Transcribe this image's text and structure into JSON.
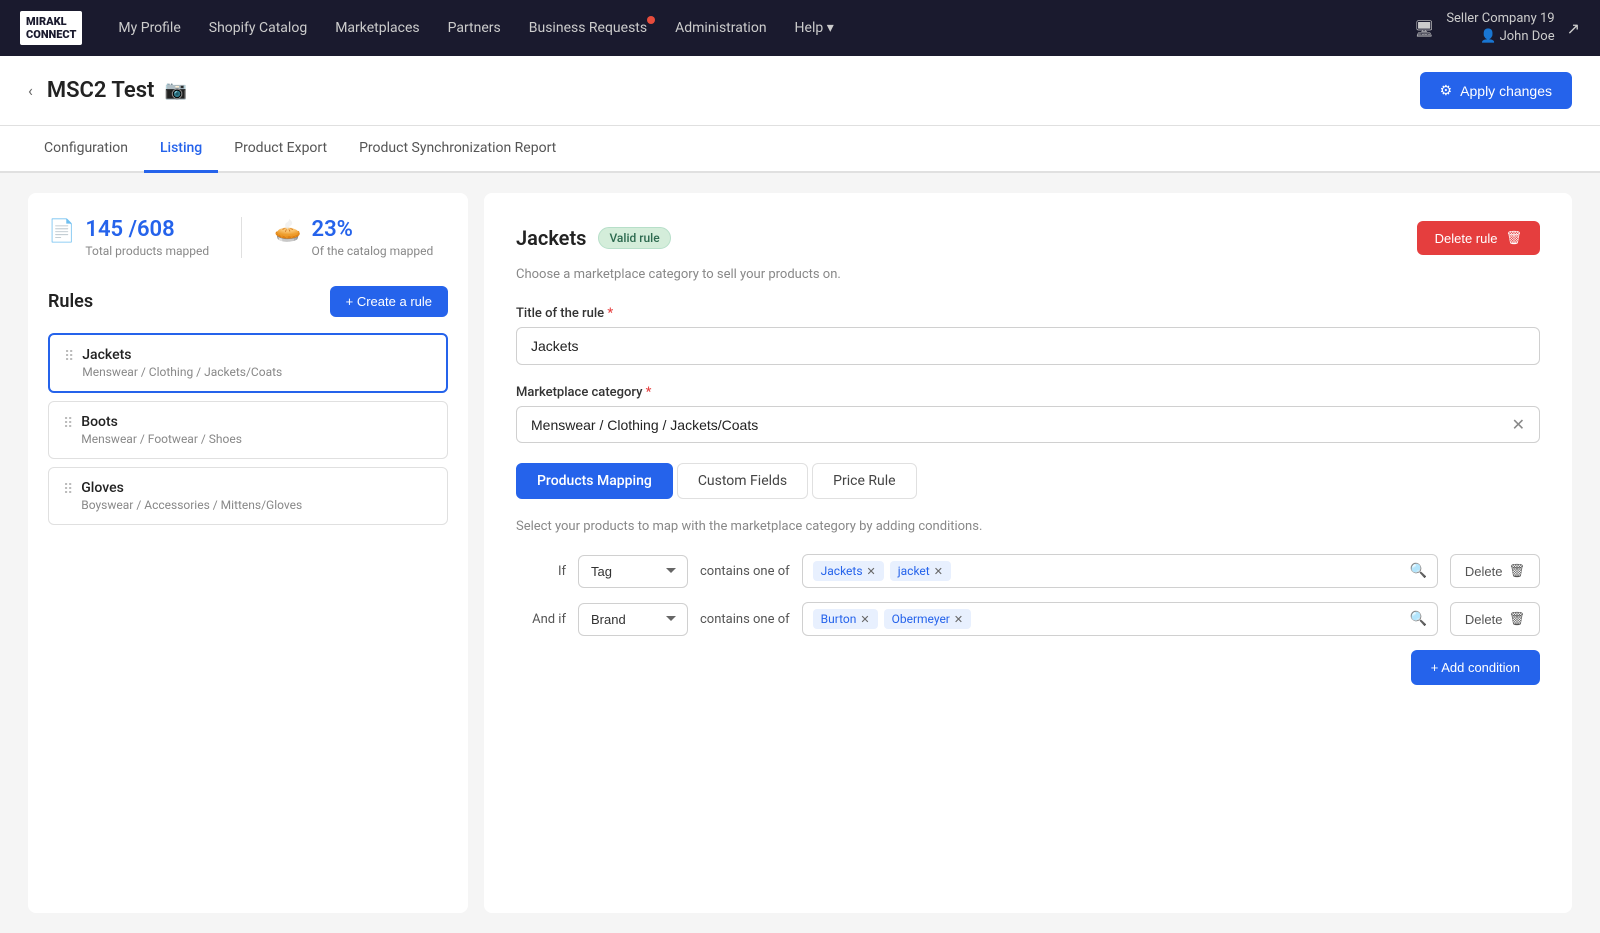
{
  "topnav": {
    "logo_line1": "MIRAKL",
    "logo_line2": "CONNECT",
    "links": [
      {
        "label": "My Profile",
        "badge": false
      },
      {
        "label": "Shopify Catalog",
        "badge": false
      },
      {
        "label": "Marketplaces",
        "badge": false
      },
      {
        "label": "Partners",
        "badge": false
      },
      {
        "label": "Business Requests",
        "badge": true
      },
      {
        "label": "Administration",
        "badge": false
      },
      {
        "label": "Help ▾",
        "badge": false
      }
    ],
    "company": "Seller Company 19",
    "user": "John Doe"
  },
  "page": {
    "back_label": "‹",
    "title": "MSC2 Test",
    "apply_btn": "Apply changes",
    "gear_icon": "⚙"
  },
  "tabs": [
    {
      "label": "Configuration",
      "active": false
    },
    {
      "label": "Listing",
      "active": true
    },
    {
      "label": "Product Export",
      "active": false
    },
    {
      "label": "Product Synchronization Report",
      "active": false
    }
  ],
  "left_panel": {
    "stat1": {
      "number": "145 /608",
      "label": "Total products mapped"
    },
    "stat2": {
      "number": "23%",
      "label": "Of the catalog mapped"
    },
    "rules_title": "Rules",
    "create_rule_btn": "+ Create a rule",
    "rules": [
      {
        "name": "Jackets",
        "path": "Menswear / Clothing / Jackets/Coats",
        "active": true
      },
      {
        "name": "Boots",
        "path": "Menswear / Footwear / Shoes",
        "active": false
      },
      {
        "name": "Gloves",
        "path": "Boyswear / Accessories / Mittens/Gloves",
        "active": false
      }
    ]
  },
  "right_panel": {
    "rule_title": "Jackets",
    "valid_badge": "Valid rule",
    "delete_btn": "Delete rule",
    "subtitle": "Choose a marketplace category to sell your products on.",
    "title_label": "Title of the rule",
    "required_marker": "*",
    "title_value": "Jackets",
    "category_label": "Marketplace category",
    "category_value": "Menswear / Clothing / Jackets/Coats",
    "sub_tabs": [
      {
        "label": "Products Mapping",
        "active": true
      },
      {
        "label": "Custom Fields",
        "active": false
      },
      {
        "label": "Price Rule",
        "active": false
      }
    ],
    "mapping_desc": "Select your products to map with the marketplace category by adding conditions.",
    "conditions": [
      {
        "prefix": "If",
        "field": "Tag",
        "operator": "contains one of",
        "tags": [
          "Jackets",
          "jacket"
        ],
        "delete_label": "Delete"
      },
      {
        "prefix": "And if",
        "field": "Brand",
        "operator": "contains one of",
        "tags": [
          "Burton",
          "Obermeyer"
        ],
        "delete_label": "Delete"
      }
    ],
    "add_condition_btn": "+ Add condition"
  }
}
